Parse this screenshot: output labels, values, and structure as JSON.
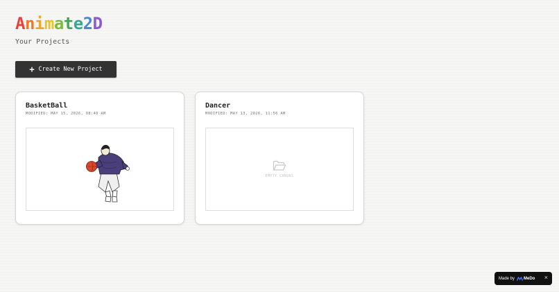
{
  "app": {
    "logo_letters": [
      {
        "ch": "A",
        "color": "#e8413a"
      },
      {
        "ch": "n",
        "color": "#ee7a2a"
      },
      {
        "ch": "i",
        "color": "#e9a92a"
      },
      {
        "ch": "m",
        "color": "#e6c42b"
      },
      {
        "ch": "a",
        "color": "#7bbd3a"
      },
      {
        "ch": "t",
        "color": "#3daa55"
      },
      {
        "ch": "e",
        "color": "#35a88f"
      },
      {
        "ch": "2",
        "color": "#4a86d6"
      },
      {
        "ch": "D",
        "color": "#8a5ad0"
      }
    ],
    "subtitle": "Your Projects"
  },
  "toolbar": {
    "create_icon": "+",
    "create_label": "Create New Project"
  },
  "projects": [
    {
      "title": "BasketBall",
      "modified": "MODIFIED: MAY 15, 2026, 08:40 AM",
      "preview": "basketball-player-illustration"
    },
    {
      "title": "Dancer",
      "modified": "MODIFIED: MAY 13, 2026, 11:56 AM",
      "preview": "empty",
      "empty_label": "EMPTY CANVAS"
    }
  ],
  "badge": {
    "made_by": "Made by",
    "brand": "MeDo",
    "close": "×"
  },
  "colors": {
    "button_bg": "#333333",
    "badge_bg": "#111111",
    "ball": "#d9482a",
    "hoodie": "#4a3f7a"
  }
}
